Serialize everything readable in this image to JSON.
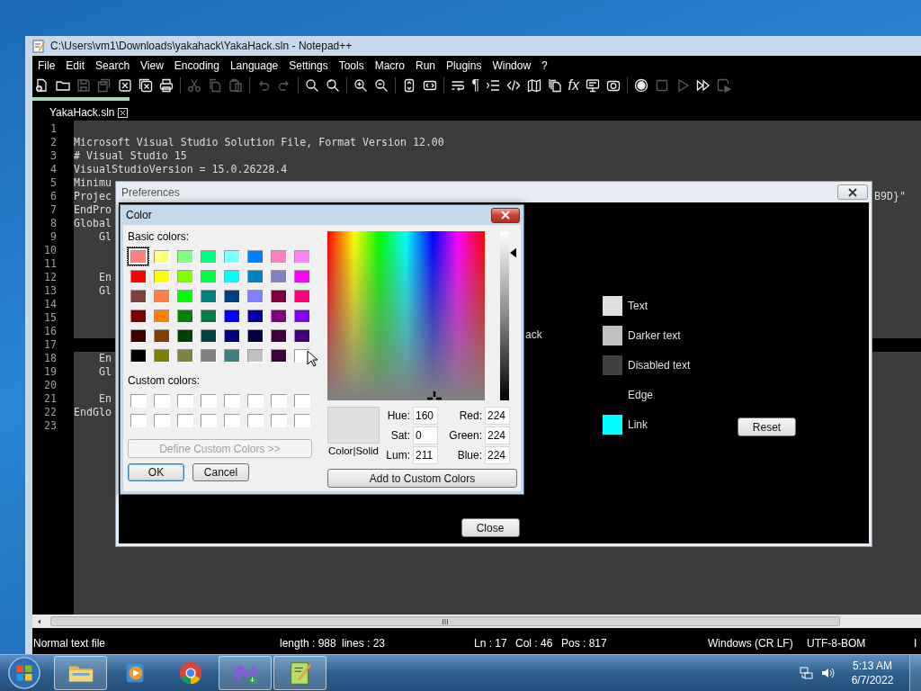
{
  "window": {
    "title": "C:\\Users\\vm1\\Downloads\\yakahack\\YakaHack.sln - Notepad++"
  },
  "menu": [
    "File",
    "Edit",
    "Search",
    "View",
    "Encoding",
    "Language",
    "Settings",
    "Tools",
    "Macro",
    "Run",
    "Plugins",
    "Window",
    "?"
  ],
  "toolbar": [
    {
      "kind": "new-file",
      "disabled": false
    },
    {
      "kind": "folder",
      "disabled": false
    },
    {
      "kind": "save",
      "disabled": true
    },
    {
      "kind": "save-all",
      "disabled": true
    },
    {
      "kind": "close",
      "disabled": false
    },
    {
      "kind": "close-all",
      "disabled": false
    },
    {
      "kind": "printer",
      "disabled": false
    },
    {
      "kind": "separator"
    },
    {
      "kind": "scissors",
      "disabled": true
    },
    {
      "kind": "copy",
      "disabled": true
    },
    {
      "kind": "clipboard",
      "disabled": true
    },
    {
      "kind": "separator"
    },
    {
      "kind": "undo",
      "disabled": true
    },
    {
      "kind": "redo",
      "disabled": true
    },
    {
      "kind": "separator"
    },
    {
      "kind": "search",
      "disabled": false
    },
    {
      "kind": "replace",
      "disabled": false
    },
    {
      "kind": "separator"
    },
    {
      "kind": "zoom-in",
      "disabled": false
    },
    {
      "kind": "zoom-out",
      "disabled": false
    },
    {
      "kind": "separator"
    },
    {
      "kind": "vertical-sync",
      "disabled": false
    },
    {
      "kind": "horizontal-sync",
      "disabled": false
    },
    {
      "kind": "separator"
    },
    {
      "kind": "word-wrap",
      "disabled": false
    },
    {
      "kind": "glyph",
      "text": "¶",
      "disabled": false
    },
    {
      "kind": "indent-guide",
      "disabled": false
    },
    {
      "kind": "code",
      "disabled": false
    },
    {
      "kind": "map",
      "disabled": false
    },
    {
      "kind": "documents",
      "disabled": false
    },
    {
      "kind": "glyph",
      "text": "fx",
      "disabled": false
    },
    {
      "kind": "monitor",
      "disabled": false
    },
    {
      "kind": "camera",
      "disabled": false
    },
    {
      "kind": "separator"
    },
    {
      "kind": "record",
      "disabled": false
    },
    {
      "kind": "stop",
      "disabled": true
    },
    {
      "kind": "play",
      "disabled": true
    },
    {
      "kind": "fast-forward",
      "disabled": false
    },
    {
      "kind": "save-macro",
      "disabled": true
    }
  ],
  "tabs": [
    {
      "label": "YakaHack.sln",
      "selected": true
    }
  ],
  "editor": {
    "lines": [
      {
        "number": "1",
        "current": false
      },
      {
        "number": "2",
        "text": "Microsoft Visual Studio Solution File, Format Version 12.00",
        "current": false
      },
      {
        "number": "3",
        "text": "# Visual Studio 15",
        "current": false
      },
      {
        "number": "4",
        "text": "VisualStudioVersion = 15.0.26228.4",
        "current": false
      },
      {
        "number": "5",
        "text": "Minimu",
        "current": false
      },
      {
        "number": "6",
        "text": "Projec",
        "tail": "B9D}\"",
        "current": false
      },
      {
        "number": "7",
        "text": "EndPro",
        "current": false
      },
      {
        "number": "8",
        "text": "Global",
        "current": false
      },
      {
        "number": "9",
        "text": "    Gl",
        "current": false
      },
      {
        "number": "10",
        "current": false
      },
      {
        "number": "11",
        "current": false
      },
      {
        "number": "12",
        "text": "    En",
        "current": false
      },
      {
        "number": "13",
        "text": "    Gl",
        "current": false
      },
      {
        "number": "14",
        "current": false
      },
      {
        "number": "15",
        "current": false
      },
      {
        "number": "16",
        "current": false
      },
      {
        "number": "17",
        "current": true
      },
      {
        "number": "18",
        "text": "    En",
        "current": false
      },
      {
        "number": "19",
        "text": "    Gl",
        "current": false
      },
      {
        "number": "20",
        "current": false
      },
      {
        "number": "21",
        "text": "    En",
        "current": false
      },
      {
        "number": "22",
        "text": "EndGlo",
        "current": false
      },
      {
        "number": "23",
        "current": false
      }
    ]
  },
  "status_bar": [
    "Normal text file",
    "length : 988",
    "lines : 23",
    "Ln : 17",
    "Col : 46",
    "Pos : 817",
    "Windows (CR LF)",
    "UTF-8-BOM",
    "I"
  ],
  "preferences": {
    "title": "Preferences",
    "partial_label": "ack",
    "colors": [
      {
        "label": "Text",
        "color": "#e0e0e0"
      },
      {
        "label": "Darker text",
        "color": "#c0c0c0"
      },
      {
        "label": "Disabled text",
        "color": "#404040"
      },
      {
        "label": "Edge"
      },
      {
        "label": "Link",
        "color": "#00ffff"
      }
    ],
    "reset": "Reset",
    "close": "Close"
  },
  "color_dialog": {
    "title": "Color",
    "basic_label": "Basic colors:",
    "basic_colors": [
      {
        "color": "#ff8080",
        "selected": true
      },
      {
        "color": "#ffff80",
        "selected": false
      },
      {
        "color": "#80ff80",
        "selected": false
      },
      {
        "color": "#00ff80",
        "selected": false
      },
      {
        "color": "#80ffff",
        "selected": false
      },
      {
        "color": "#0080ff",
        "selected": false
      },
      {
        "color": "#ff80c0",
        "selected": false
      },
      {
        "color": "#ff80ff",
        "selected": false
      },
      {
        "color": "#ff0000",
        "selected": false
      },
      {
        "color": "#ffff00",
        "selected": false
      },
      {
        "color": "#80ff00",
        "selected": false
      },
      {
        "color": "#00ff40",
        "selected": false
      },
      {
        "color": "#00ffff",
        "selected": false
      },
      {
        "color": "#0080c0",
        "selected": false
      },
      {
        "color": "#8080c0",
        "selected": false
      },
      {
        "color": "#ff00ff",
        "selected": false
      },
      {
        "color": "#804040",
        "selected": false
      },
      {
        "color": "#ff8040",
        "selected": false
      },
      {
        "color": "#00ff00",
        "selected": false
      },
      {
        "color": "#008080",
        "selected": false
      },
      {
        "color": "#004080",
        "selected": false
      },
      {
        "color": "#8080ff",
        "selected": false
      },
      {
        "color": "#800040",
        "selected": false
      },
      {
        "color": "#ff0080",
        "selected": false
      },
      {
        "color": "#800000",
        "selected": false
      },
      {
        "color": "#ff8000",
        "selected": false
      },
      {
        "color": "#008000",
        "selected": false
      },
      {
        "color": "#008040",
        "selected": false
      },
      {
        "color": "#0000ff",
        "selected": false
      },
      {
        "color": "#0000a0",
        "selected": false
      },
      {
        "color": "#800080",
        "selected": false
      },
      {
        "color": "#8000ff",
        "selected": false
      },
      {
        "color": "#400000",
        "selected": false
      },
      {
        "color": "#804000",
        "selected": false
      },
      {
        "color": "#004000",
        "selected": false
      },
      {
        "color": "#004040",
        "selected": false
      },
      {
        "color": "#000080",
        "selected": false
      },
      {
        "color": "#000040",
        "selected": false
      },
      {
        "color": "#400040",
        "selected": false
      },
      {
        "color": "#400080",
        "selected": false
      },
      {
        "color": "#000000",
        "selected": false
      },
      {
        "color": "#808000",
        "selected": false
      },
      {
        "color": "#808040",
        "selected": false
      },
      {
        "color": "#808080",
        "selected": false
      },
      {
        "color": "#408080",
        "selected": false
      },
      {
        "color": "#c0c0c0",
        "selected": false
      },
      {
        "color": "#400040",
        "selected": false
      },
      {
        "color": "#ffffff",
        "selected": false
      }
    ],
    "custom_label": "Custom colors:",
    "custom_colors": [
      {
        "color": "#ffffff"
      },
      {
        "color": "#ffffff"
      },
      {
        "color": "#ffffff"
      },
      {
        "color": "#ffffff"
      },
      {
        "color": "#ffffff"
      },
      {
        "color": "#ffffff"
      },
      {
        "color": "#ffffff"
      },
      {
        "color": "#ffffff"
      },
      {
        "color": "#ffffff"
      },
      {
        "color": "#ffffff"
      },
      {
        "color": "#ffffff"
      },
      {
        "color": "#ffffff"
      },
      {
        "color": "#ffffff"
      },
      {
        "color": "#ffffff"
      },
      {
        "color": "#ffffff"
      },
      {
        "color": "#ffffff"
      }
    ],
    "define_button": {
      "label": "Define Custom Colors >>",
      "disabled": true
    },
    "ok": "OK",
    "cancel": "Cancel",
    "luminance": {
      "level": 0.87
    },
    "preview_label": "Color|Solid",
    "hsl_fields": [
      {
        "label": "Hue:",
        "value": "160"
      },
      {
        "label": "Sat:",
        "value": "0"
      },
      {
        "label": "Lum:",
        "value": "211"
      }
    ],
    "rgb_fields": [
      {
        "label": "Red:",
        "value": "224"
      },
      {
        "label": "Green:",
        "value": "224"
      },
      {
        "label": "Blue:",
        "value": "224"
      }
    ],
    "add_button": "Add to Custom Colors"
  },
  "taskbar": {
    "apps": [
      {
        "kind": "folder",
        "open": true
      },
      {
        "kind": "media",
        "open": false
      },
      {
        "kind": "browser",
        "open": false
      },
      {
        "kind": "studio",
        "open": true
      },
      {
        "kind": "notepad",
        "open": true
      }
    ],
    "time": "5:13 AM",
    "date": "6/7/2022"
  }
}
